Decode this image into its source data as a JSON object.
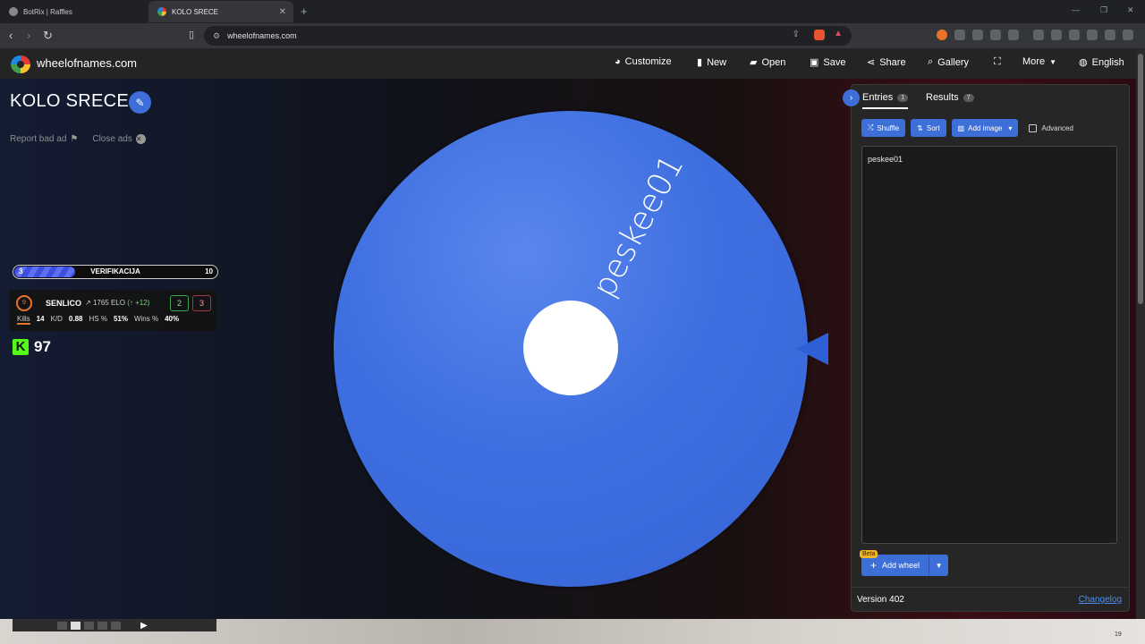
{
  "browser": {
    "tabs": [
      {
        "title": "BotRix | Raffles"
      },
      {
        "title": "KOLO SRECE"
      }
    ],
    "url": "wheelofnames.com"
  },
  "app": {
    "brand": "wheelofnames.com",
    "menu": {
      "customize": "Customize",
      "new": "New",
      "open": "Open",
      "save": "Save",
      "share": "Share",
      "gallery": "Gallery",
      "more": "More",
      "language": "English"
    }
  },
  "wheel": {
    "title": "KOLO SRECE",
    "report_ad": "Report bad ad",
    "close_ads": "Close ads",
    "segment_label": "peskee01",
    "color": "#3e6fe0"
  },
  "overlay": {
    "verif": {
      "label": "VERIFIKACIJA",
      "current": "3",
      "target": "10",
      "progress_fraction": 0.3
    },
    "player": {
      "level": "9",
      "name": "SENLICO",
      "elo": "1765 ELO",
      "elo_delta": "(↑ +12)",
      "wins": "2",
      "losses": "3",
      "stats": [
        {
          "label": "Kills",
          "value": "14"
        },
        {
          "label": "K/D",
          "value": "0.88"
        },
        {
          "label": "HS %",
          "value": "51%"
        },
        {
          "label": "Wins %",
          "value": "40%"
        }
      ]
    },
    "kick": {
      "letter": "K",
      "count": "97"
    }
  },
  "panel": {
    "tabs": {
      "entries": "Entries",
      "entries_count": "1",
      "results": "Results",
      "results_count": "7"
    },
    "tools": {
      "shuffle": "Shuffle",
      "sort": "Sort",
      "add_image": "Add image",
      "advanced": "Advanced"
    },
    "entries_text": "peskee01",
    "add_wheel": "Add wheel",
    "beta": "Beta",
    "version": "Version 402",
    "changelog": "Changelog"
  },
  "taskbar": {
    "time": "19"
  }
}
